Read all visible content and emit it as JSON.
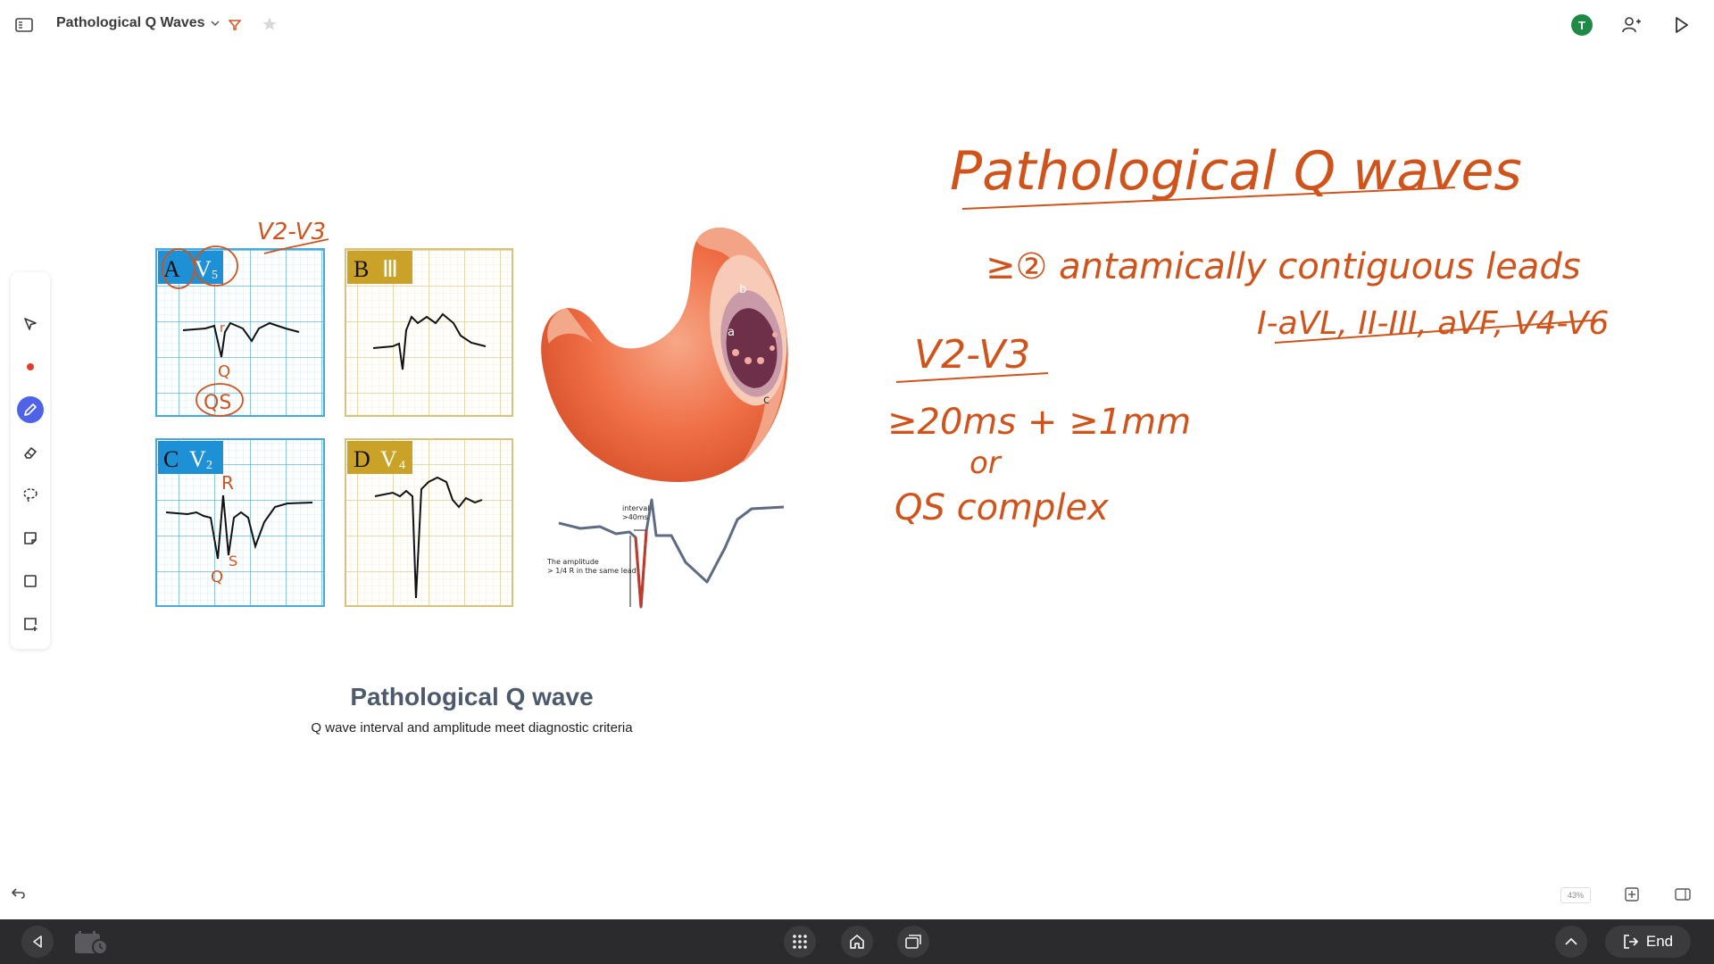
{
  "topbar": {
    "doc_title": "Pathological Q Waves",
    "avatar_initial": "T",
    "avatar_color": "#1f8a45"
  },
  "figure": {
    "panels": [
      {
        "letter": "A",
        "lead": "V",
        "sub": "5"
      },
      {
        "letter": "B",
        "lead": "Ⅲ",
        "sub": ""
      },
      {
        "letter": "C",
        "lead": "V",
        "sub": "2"
      },
      {
        "letter": "D",
        "lead": "V",
        "sub": "4"
      }
    ],
    "heart_labels": {
      "a": "a",
      "b": "b",
      "c": "c"
    },
    "ecg_interval_label_1": "interval",
    "ecg_interval_label_2": ">40ms",
    "ecg_amplitude_label_1": "The amplitude",
    "ecg_amplitude_label_2": "> 1/4 R in the same lead",
    "caption_title": "Pathological Q wave",
    "caption_sub": "Q wave interval and amplitude meet diagnostic criteria"
  },
  "handwriting": {
    "title": "Pathological Q waves",
    "line1": "≥② antamically contiguous leads",
    "line2": "I-aVL, II-III, aVF, V4-V6",
    "v2v3": "V2-V3",
    "criteria": "≥20ms + ≥1mm",
    "or": "or",
    "qs": "QS complex",
    "small_v2v3": "V2-V3",
    "annot_q": "Q",
    "annot_qs": "QS",
    "annot_r": "R",
    "annot_q2": "Q",
    "annot_s": "S",
    "annot_r2": "r"
  },
  "status": {
    "zoom": "43%"
  },
  "taskbar": {
    "end_label": "End"
  },
  "colors": {
    "accent": "#4f63e8",
    "ink": "#d0531c",
    "panel_blue": "#1e90d6",
    "panel_gold": "#c9a227"
  }
}
